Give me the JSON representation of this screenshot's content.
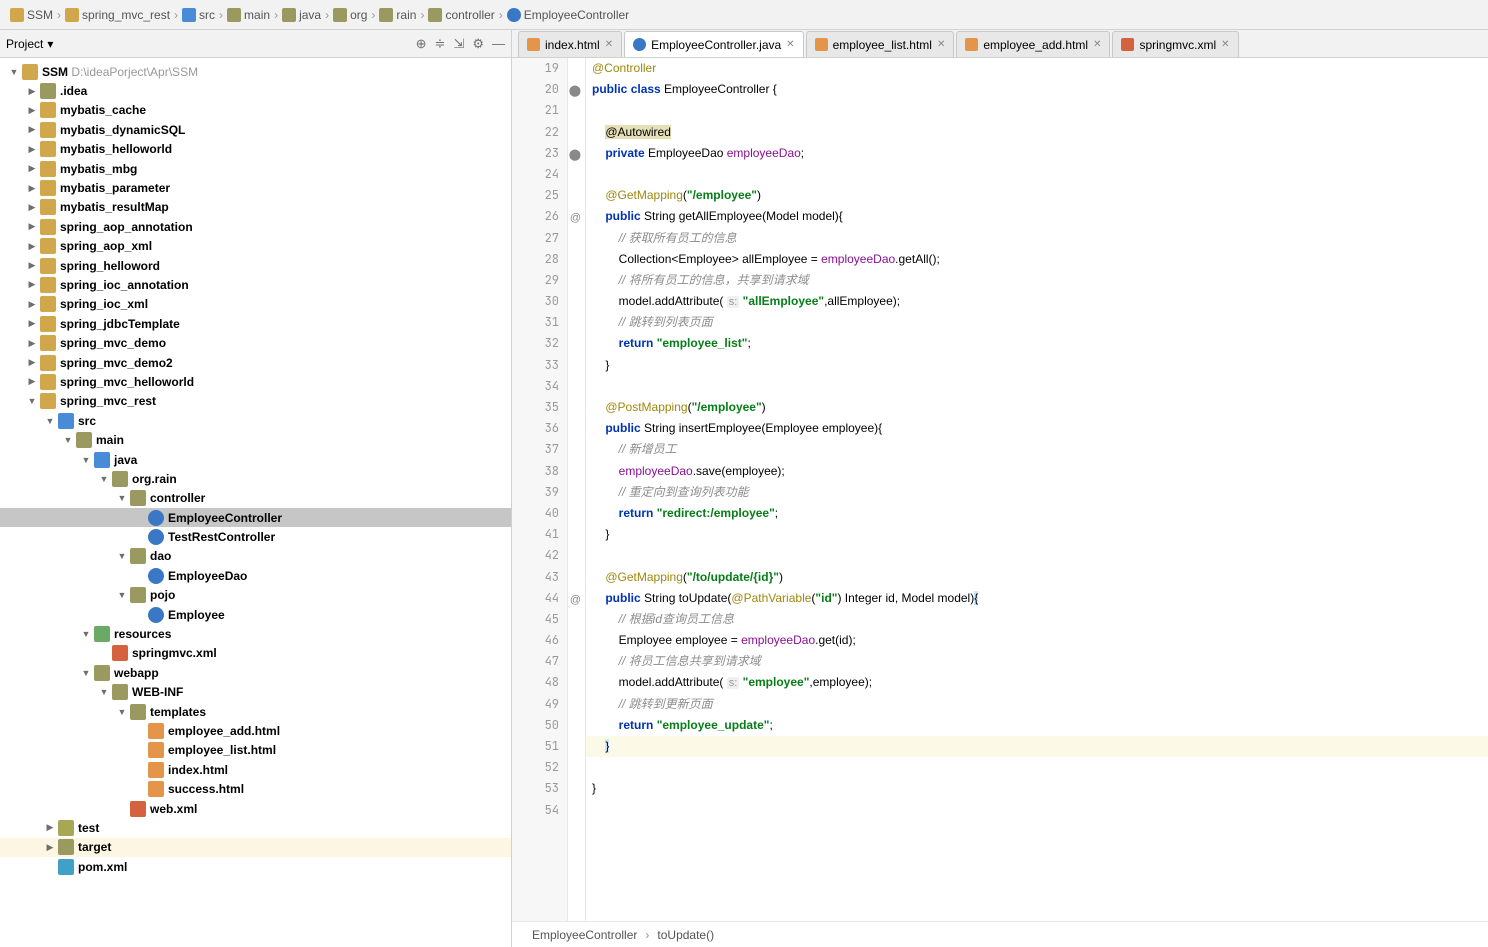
{
  "breadcrumb": [
    "SSM",
    "spring_mvc_rest",
    "src",
    "main",
    "java",
    "org",
    "rain",
    "controller",
    "EmployeeController"
  ],
  "breadcrumb_icons": [
    "fold-m",
    "fold-m",
    "fold-b",
    "fold",
    "fold",
    "fold",
    "fold",
    "fold",
    "fileC"
  ],
  "sidebar": {
    "title": "Project",
    "expand_icon": "▾"
  },
  "tree": [
    {
      "d": 0,
      "a": "expanded",
      "i": "fold-m",
      "t": "SSM",
      "gray": " D:\\ideaPorject\\Apr\\SSM"
    },
    {
      "d": 1,
      "a": "collapsed",
      "i": "fold",
      "t": ".idea"
    },
    {
      "d": 1,
      "a": "collapsed",
      "i": "fold-m",
      "t": "mybatis_cache"
    },
    {
      "d": 1,
      "a": "collapsed",
      "i": "fold-m",
      "t": "mybatis_dynamicSQL"
    },
    {
      "d": 1,
      "a": "collapsed",
      "i": "fold-m",
      "t": "mybatis_helloworld"
    },
    {
      "d": 1,
      "a": "collapsed",
      "i": "fold-m",
      "t": "mybatis_mbg"
    },
    {
      "d": 1,
      "a": "collapsed",
      "i": "fold-m",
      "t": "mybatis_parameter"
    },
    {
      "d": 1,
      "a": "collapsed",
      "i": "fold-m",
      "t": "mybatis_resultMap"
    },
    {
      "d": 1,
      "a": "collapsed",
      "i": "fold-m",
      "t": "spring_aop_annotation"
    },
    {
      "d": 1,
      "a": "collapsed",
      "i": "fold-m",
      "t": "spring_aop_xml"
    },
    {
      "d": 1,
      "a": "collapsed",
      "i": "fold-m",
      "t": "spring_helloword"
    },
    {
      "d": 1,
      "a": "collapsed",
      "i": "fold-m",
      "t": "spring_ioc_annotation"
    },
    {
      "d": 1,
      "a": "collapsed",
      "i": "fold-m",
      "t": "spring_ioc_xml"
    },
    {
      "d": 1,
      "a": "collapsed",
      "i": "fold-m",
      "t": "spring_jdbcTemplate"
    },
    {
      "d": 1,
      "a": "collapsed",
      "i": "fold-m",
      "t": "spring_mvc_demo"
    },
    {
      "d": 1,
      "a": "collapsed",
      "i": "fold-m",
      "t": "spring_mvc_demo2"
    },
    {
      "d": 1,
      "a": "collapsed",
      "i": "fold-m",
      "t": "spring_mvc_helloworld"
    },
    {
      "d": 1,
      "a": "expanded",
      "i": "fold-m",
      "t": "spring_mvc_rest"
    },
    {
      "d": 2,
      "a": "expanded",
      "i": "fold-b",
      "t": "src"
    },
    {
      "d": 3,
      "a": "expanded",
      "i": "fold",
      "t": "main"
    },
    {
      "d": 4,
      "a": "expanded",
      "i": "fold-b",
      "t": "java"
    },
    {
      "d": 5,
      "a": "expanded",
      "i": "fold",
      "t": "org.rain"
    },
    {
      "d": 6,
      "a": "expanded",
      "i": "fold",
      "t": "controller"
    },
    {
      "d": 7,
      "a": "",
      "i": "fileC",
      "t": "EmployeeController",
      "sel": true
    },
    {
      "d": 7,
      "a": "",
      "i": "fileC",
      "t": "TestRestController"
    },
    {
      "d": 6,
      "a": "expanded",
      "i": "fold",
      "t": "dao"
    },
    {
      "d": 7,
      "a": "",
      "i": "fileC",
      "t": "EmployeeDao"
    },
    {
      "d": 6,
      "a": "expanded",
      "i": "fold",
      "t": "pojo"
    },
    {
      "d": 7,
      "a": "",
      "i": "fileC",
      "t": "Employee"
    },
    {
      "d": 4,
      "a": "expanded",
      "i": "fold-g",
      "t": "resources"
    },
    {
      "d": 5,
      "a": "",
      "i": "fileX",
      "t": "springmvc.xml"
    },
    {
      "d": 4,
      "a": "expanded",
      "i": "fold",
      "t": "webapp"
    },
    {
      "d": 5,
      "a": "expanded",
      "i": "fold",
      "t": "WEB-INF"
    },
    {
      "d": 6,
      "a": "expanded",
      "i": "fold",
      "t": "templates"
    },
    {
      "d": 7,
      "a": "",
      "i": "fileH",
      "t": "employee_add.html"
    },
    {
      "d": 7,
      "a": "",
      "i": "fileH",
      "t": "employee_list.html"
    },
    {
      "d": 7,
      "a": "",
      "i": "fileH",
      "t": "index.html"
    },
    {
      "d": 7,
      "a": "",
      "i": "fileH",
      "t": "success.html"
    },
    {
      "d": 6,
      "a": "",
      "i": "fileX",
      "t": "web.xml"
    },
    {
      "d": 2,
      "a": "collapsed",
      "i": "fold-t",
      "t": "test"
    },
    {
      "d": 2,
      "a": "collapsed",
      "i": "fold",
      "t": "target",
      "tint": true
    },
    {
      "d": 2,
      "a": "",
      "i": "fileM",
      "t": "pom.xml"
    }
  ],
  "tabs": [
    {
      "i": "fileH",
      "t": "index.html"
    },
    {
      "i": "fileC",
      "t": "EmployeeController.java",
      "active": true
    },
    {
      "i": "fileH",
      "t": "employee_list.html"
    },
    {
      "i": "fileH",
      "t": "employee_add.html"
    },
    {
      "i": "fileX",
      "t": "springmvc.xml"
    }
  ],
  "code": {
    "start": 19,
    "lines": [
      {
        "h": "<span class='ann'>@Controller</span>"
      },
      {
        "h": "<span class='kw'>public</span> <span class='kw'>class</span> EmployeeController {",
        "mark": "⬤"
      },
      {
        "h": ""
      },
      {
        "h": "    <span class='ann-hl'>@Autowired</span>"
      },
      {
        "h": "    <span class='kw'>private</span> EmployeeDao <span class='fld'>employeeDao</span>;",
        "mark": "⬤"
      },
      {
        "h": ""
      },
      {
        "h": "    <span class='ann'>@GetMapping</span>(<span class='str'>\"/employee\"</span>)"
      },
      {
        "h": "    <span class='kw'>public</span> String getAllEmployee(Model model){",
        "mark": "@"
      },
      {
        "h": "        <span class='cmt'>// 获取所有员工的信息</span>"
      },
      {
        "h": "        Collection&lt;Employee&gt; allEmployee = <span class='fld'>employeeDao</span>.getAll();"
      },
      {
        "h": "        <span class='cmt'>// 将所有员工的信息，共享到请求域</span>"
      },
      {
        "h": "        model.addAttribute( <span class='hint'>s:</span> <span class='str'>\"allEmployee\"</span>,allEmployee);"
      },
      {
        "h": "        <span class='cmt'>// 跳转到列表页面</span>"
      },
      {
        "h": "        <span class='kw'>return</span> <span class='str'>\"employee_list\"</span>;"
      },
      {
        "h": "    }"
      },
      {
        "h": ""
      },
      {
        "h": "    <span class='ann'>@PostMapping</span>(<span class='str'>\"/employee\"</span>)"
      },
      {
        "h": "    <span class='kw'>public</span> String insertEmployee(Employee employee){"
      },
      {
        "h": "        <span class='cmt'>// 新增员工</span>"
      },
      {
        "h": "        <span class='fld'>employeeDao</span>.save(employee);"
      },
      {
        "h": "        <span class='cmt'>// 重定向到查询列表功能</span>"
      },
      {
        "h": "        <span class='kw'>return</span> <span class='str'>\"redirect:/employee\"</span>;"
      },
      {
        "h": "    }"
      },
      {
        "h": ""
      },
      {
        "h": "    <span class='ann'>@GetMapping</span>(<span class='str'>\"/to/update/{id}\"</span>)"
      },
      {
        "h": "    <span class='kw'>public</span> String toUpdate(<span class='ann'>@PathVariable</span>(<span class='str'>\"id\"</span>) Integer id, Model model)<span class='curbrace'>{</span>",
        "mark": "@"
      },
      {
        "h": "        <span class='cmt'>// 根据id查询员工信息</span>"
      },
      {
        "h": "        Employee employee = <span class='fld'>employeeDao</span>.get(id);"
      },
      {
        "h": "        <span class='cmt'>// 将员工信息共享到请求域</span>"
      },
      {
        "h": "        model.addAttribute( <span class='hint'>s:</span> <span class='str'>\"employee\"</span>,employee);"
      },
      {
        "h": "        <span class='cmt'>// 跳转到更新页面</span>"
      },
      {
        "h": "        <span class='kw'>return</span> <span class='str'>\"employee_update\"</span>;"
      },
      {
        "h": "    <span class='curbrace'>}</span>",
        "cur": true
      },
      {
        "h": ""
      },
      {
        "h": "}"
      },
      {
        "h": ""
      }
    ]
  },
  "status": {
    "class": "EmployeeController",
    "method": "toUpdate()"
  }
}
